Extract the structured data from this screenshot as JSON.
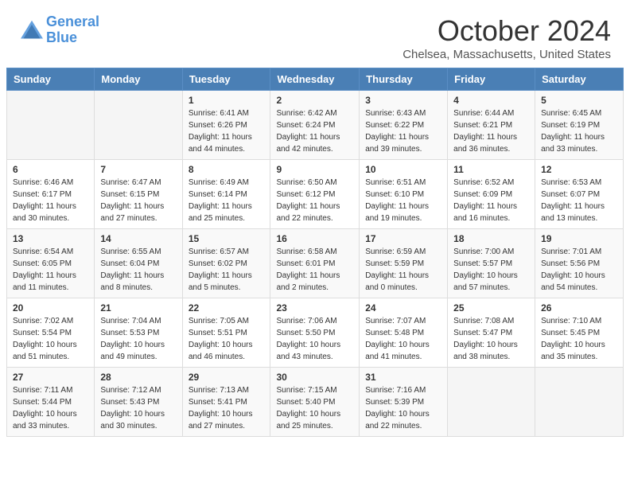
{
  "header": {
    "logo_line1": "General",
    "logo_line2": "Blue",
    "month_title": "October 2024",
    "location": "Chelsea, Massachusetts, United States"
  },
  "days_of_week": [
    "Sunday",
    "Monday",
    "Tuesday",
    "Wednesday",
    "Thursday",
    "Friday",
    "Saturday"
  ],
  "weeks": [
    [
      {
        "day": "",
        "info": ""
      },
      {
        "day": "",
        "info": ""
      },
      {
        "day": "1",
        "info": "Sunrise: 6:41 AM\nSunset: 6:26 PM\nDaylight: 11 hours and 44 minutes."
      },
      {
        "day": "2",
        "info": "Sunrise: 6:42 AM\nSunset: 6:24 PM\nDaylight: 11 hours and 42 minutes."
      },
      {
        "day": "3",
        "info": "Sunrise: 6:43 AM\nSunset: 6:22 PM\nDaylight: 11 hours and 39 minutes."
      },
      {
        "day": "4",
        "info": "Sunrise: 6:44 AM\nSunset: 6:21 PM\nDaylight: 11 hours and 36 minutes."
      },
      {
        "day": "5",
        "info": "Sunrise: 6:45 AM\nSunset: 6:19 PM\nDaylight: 11 hours and 33 minutes."
      }
    ],
    [
      {
        "day": "6",
        "info": "Sunrise: 6:46 AM\nSunset: 6:17 PM\nDaylight: 11 hours and 30 minutes."
      },
      {
        "day": "7",
        "info": "Sunrise: 6:47 AM\nSunset: 6:15 PM\nDaylight: 11 hours and 27 minutes."
      },
      {
        "day": "8",
        "info": "Sunrise: 6:49 AM\nSunset: 6:14 PM\nDaylight: 11 hours and 25 minutes."
      },
      {
        "day": "9",
        "info": "Sunrise: 6:50 AM\nSunset: 6:12 PM\nDaylight: 11 hours and 22 minutes."
      },
      {
        "day": "10",
        "info": "Sunrise: 6:51 AM\nSunset: 6:10 PM\nDaylight: 11 hours and 19 minutes."
      },
      {
        "day": "11",
        "info": "Sunrise: 6:52 AM\nSunset: 6:09 PM\nDaylight: 11 hours and 16 minutes."
      },
      {
        "day": "12",
        "info": "Sunrise: 6:53 AM\nSunset: 6:07 PM\nDaylight: 11 hours and 13 minutes."
      }
    ],
    [
      {
        "day": "13",
        "info": "Sunrise: 6:54 AM\nSunset: 6:05 PM\nDaylight: 11 hours and 11 minutes."
      },
      {
        "day": "14",
        "info": "Sunrise: 6:55 AM\nSunset: 6:04 PM\nDaylight: 11 hours and 8 minutes."
      },
      {
        "day": "15",
        "info": "Sunrise: 6:57 AM\nSunset: 6:02 PM\nDaylight: 11 hours and 5 minutes."
      },
      {
        "day": "16",
        "info": "Sunrise: 6:58 AM\nSunset: 6:01 PM\nDaylight: 11 hours and 2 minutes."
      },
      {
        "day": "17",
        "info": "Sunrise: 6:59 AM\nSunset: 5:59 PM\nDaylight: 11 hours and 0 minutes."
      },
      {
        "day": "18",
        "info": "Sunrise: 7:00 AM\nSunset: 5:57 PM\nDaylight: 10 hours and 57 minutes."
      },
      {
        "day": "19",
        "info": "Sunrise: 7:01 AM\nSunset: 5:56 PM\nDaylight: 10 hours and 54 minutes."
      }
    ],
    [
      {
        "day": "20",
        "info": "Sunrise: 7:02 AM\nSunset: 5:54 PM\nDaylight: 10 hours and 51 minutes."
      },
      {
        "day": "21",
        "info": "Sunrise: 7:04 AM\nSunset: 5:53 PM\nDaylight: 10 hours and 49 minutes."
      },
      {
        "day": "22",
        "info": "Sunrise: 7:05 AM\nSunset: 5:51 PM\nDaylight: 10 hours and 46 minutes."
      },
      {
        "day": "23",
        "info": "Sunrise: 7:06 AM\nSunset: 5:50 PM\nDaylight: 10 hours and 43 minutes."
      },
      {
        "day": "24",
        "info": "Sunrise: 7:07 AM\nSunset: 5:48 PM\nDaylight: 10 hours and 41 minutes."
      },
      {
        "day": "25",
        "info": "Sunrise: 7:08 AM\nSunset: 5:47 PM\nDaylight: 10 hours and 38 minutes."
      },
      {
        "day": "26",
        "info": "Sunrise: 7:10 AM\nSunset: 5:45 PM\nDaylight: 10 hours and 35 minutes."
      }
    ],
    [
      {
        "day": "27",
        "info": "Sunrise: 7:11 AM\nSunset: 5:44 PM\nDaylight: 10 hours and 33 minutes."
      },
      {
        "day": "28",
        "info": "Sunrise: 7:12 AM\nSunset: 5:43 PM\nDaylight: 10 hours and 30 minutes."
      },
      {
        "day": "29",
        "info": "Sunrise: 7:13 AM\nSunset: 5:41 PM\nDaylight: 10 hours and 27 minutes."
      },
      {
        "day": "30",
        "info": "Sunrise: 7:15 AM\nSunset: 5:40 PM\nDaylight: 10 hours and 25 minutes."
      },
      {
        "day": "31",
        "info": "Sunrise: 7:16 AM\nSunset: 5:39 PM\nDaylight: 10 hours and 22 minutes."
      },
      {
        "day": "",
        "info": ""
      },
      {
        "day": "",
        "info": ""
      }
    ]
  ]
}
